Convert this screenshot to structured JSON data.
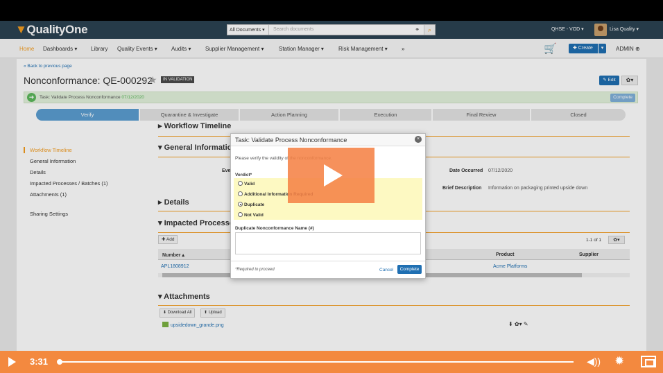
{
  "header": {
    "logo": "QualityOne",
    "search_scope": "All Documents ▾",
    "search_placeholder": "Search documents",
    "site_selector": "QHSE - VOD ▾",
    "user_name": "Lisa Quality ▾"
  },
  "nav": {
    "items": [
      "Home",
      "Dashboards ▾",
      "Library",
      "Quality Events ▾",
      "Audits ▾",
      "Supplier Management ▾",
      "Station Manager ▾",
      "Risk Management ▾",
      "»"
    ],
    "create_label": "✚ Create",
    "admin_label": "ADMIN ⊕"
  },
  "record": {
    "back_link": "« Back to previous page",
    "title": "Nonconformance: QE-000292",
    "status": "IN VALIDATION",
    "edit_label": "✎ Edit",
    "task_text": "Task: Validate Process Nonconformance",
    "task_date": "07/12/2020",
    "task_complete": "Complete"
  },
  "steps": [
    "Verify",
    "Quarantine & Investigate",
    "Action Planning",
    "Execution",
    "Final Review",
    "Closed"
  ],
  "sidebar": {
    "items": [
      "Workflow Timeline",
      "General Information",
      "Details",
      "Impacted Processes / Batches (1)",
      "Attachments (1)",
      "Sharing Settings"
    ]
  },
  "sections": {
    "workflow": "▸ Workflow Timeline",
    "general": "▾ General Informatio",
    "details": "▸ Details",
    "impacted": "▾ Impacted Processe",
    "attachments": "▾ Attachments"
  },
  "general_fields": {
    "event_label": "Eve",
    "date_occurred_label": "Date Occurred",
    "date_occurred_value": "07/12/2020",
    "brief_label": "Brief Description",
    "brief_value": "Information on packaging printed upside down"
  },
  "impacted": {
    "add_label": "✚ Add",
    "pager": "1-1 of 1",
    "columns": [
      "Number ▴",
      "Product",
      "Supplier"
    ],
    "row": {
      "number": "APL1808912",
      "product": "Acme Platforms"
    }
  },
  "attachments": {
    "download_all": "⬇ Download All",
    "upload": "⬆ Upload",
    "file": "upsidedown_grande.png",
    "actions": "⬇ ✿▾ ✎"
  },
  "modal": {
    "title": "Task: Validate Process Nonconformance",
    "instruction": "Please verify the validity of the nonconformance.",
    "verdict_label": "Verdict*",
    "options": [
      {
        "label": "Valid",
        "selected": false
      },
      {
        "label": "Additional Information Required",
        "selected": false
      },
      {
        "label": "Duplicate",
        "selected": true
      },
      {
        "label": "Not Valid",
        "selected": false
      }
    ],
    "duplicate_label": "Duplicate Nonconformance Name (#)",
    "required_note": "*Required to proceed",
    "cancel_label": "Cancel",
    "complete_label": "Complete"
  },
  "video": {
    "time": "3:31",
    "progress": 0.005
  },
  "colors": {
    "accent": "#f39c1f",
    "primary": "#1f6fb2",
    "header_bg": "#2b4252",
    "video_bar": "#f3893f",
    "verdict_highlight": "#fdf9c2"
  }
}
